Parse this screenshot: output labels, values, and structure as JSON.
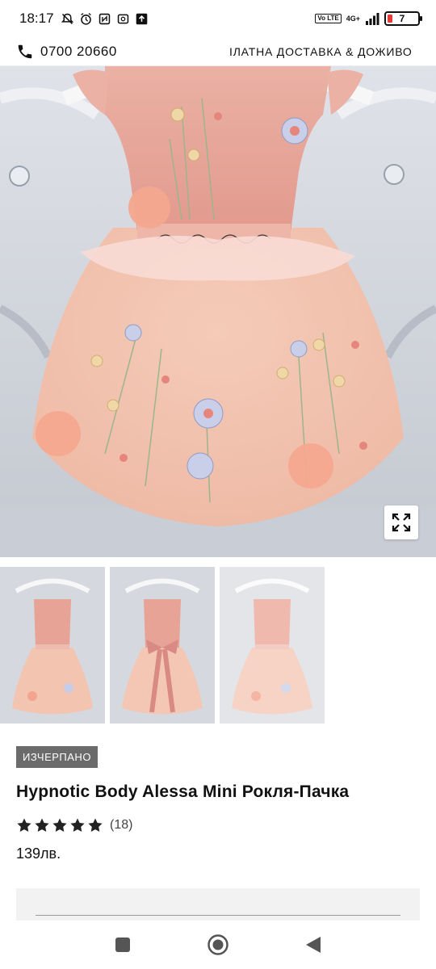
{
  "status_bar": {
    "time": "18:17",
    "network": "4G+",
    "volte": "Vo LTE",
    "battery": "7",
    "battery_color": "#e53935"
  },
  "header": {
    "phone": "0700 20660",
    "phone_icon": "phone-icon",
    "promo": "ІЛАТНА ДОСТАВКА & ДОЖИВО"
  },
  "gallery": {
    "expand_icon": "expand-icon",
    "thumbnails": [
      "dress-front",
      "dress-back",
      "dress-front-light"
    ]
  },
  "product": {
    "badge": "ИЗЧЕРПАНО",
    "title": "Hypnotic Body Alessa Mini Рокля-Пачка",
    "rating": 5,
    "reviews": "(18)",
    "price": "139лв."
  },
  "colors": {
    "dress_pink": "#e8a79a",
    "tulle_peach": "#f4c2ae",
    "background_sofa": "#cfd3db",
    "badge_gray": "#6b6b6b"
  },
  "navigation": {
    "recents": "square-icon",
    "home": "circle-icon",
    "back": "triangle-back-icon"
  }
}
